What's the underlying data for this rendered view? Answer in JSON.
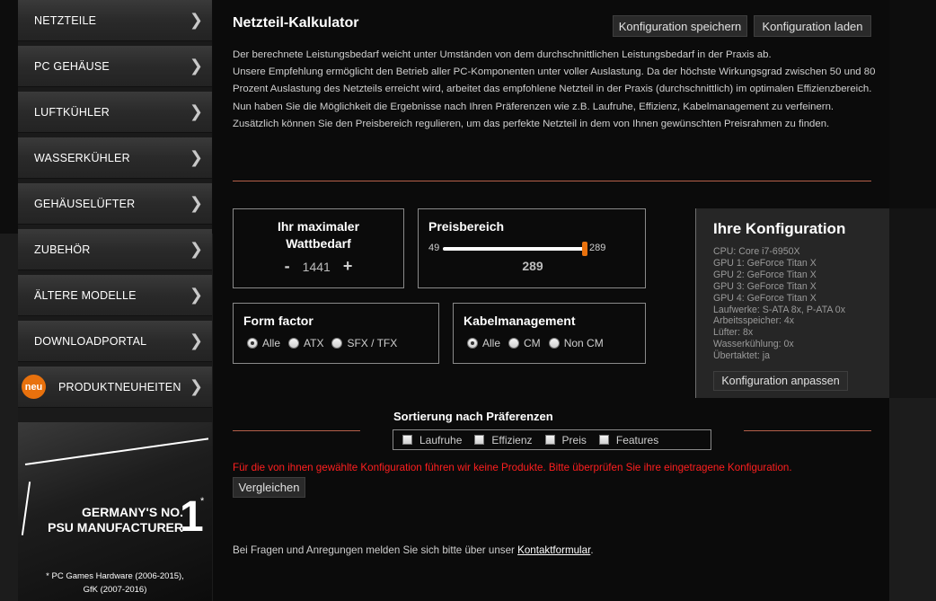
{
  "sidebar": {
    "items": [
      {
        "label": "NETZTEILE"
      },
      {
        "label": "PC GEHÄUSE"
      },
      {
        "label": "LUFTKÜHLER"
      },
      {
        "label": "WASSERKÜHLER"
      },
      {
        "label": "GEHÄUSELÜFTER"
      },
      {
        "label": "ZUBEHÖR"
      },
      {
        "label": "ÄLTERE MODELLE"
      },
      {
        "label": "DOWNLOADPORTAL"
      },
      {
        "label": "PRODUKTNEUHEITEN",
        "badge": "neu"
      }
    ],
    "chevron_icon": "chevron-right-icon",
    "promo": {
      "line1": "GERMANY'S NO.",
      "line2": "PSU MANUFACTURER",
      "number": "1",
      "star": "*",
      "footnote1": "* PC Games Hardware (2006-2015),",
      "footnote2": "GfK (2007-2016)"
    }
  },
  "main": {
    "title": "Netzteil-Kalkulator",
    "save_button": "Konfiguration speichern",
    "load_button": "Konfiguration laden",
    "intro": [
      "Der berechnete Leistungsbedarf weicht unter Umständen von dem durchschnittlichen Leistungsbedarf in der Praxis ab.",
      "Unsere Empfehlung ermöglicht den Betrieb aller PC-Komponenten unter voller Auslastung. Da der höchste Wirkungsgrad zwischen 50 und 80 Prozent Auslastung des Netzteils erreicht wird, arbeitet das empfohlene Netzteil in der Praxis (durchschnittlich) im optimalen Effizienzbereich.",
      "Nun haben Sie die Möglichkeit die Ergebnisse nach Ihren Präferenzen wie z.B. Laufruhe, Effizienz, Kabelmanagement zu verfeinern. Zusätzlich können Sie den Preisbereich regulieren, um das perfekte Netzteil in dem von Ihnen gewünschten Preisrahmen zu finden."
    ],
    "watt": {
      "title_line1": "Ihr maximaler",
      "title_line2": "Wattbedarf",
      "minus": "-",
      "value": "1441",
      "plus": "+"
    },
    "price": {
      "title": "Preisbereich",
      "min": "49",
      "max": "289",
      "value": "289",
      "slider_level": 1.0
    },
    "form_factor": {
      "title": "Form factor",
      "options": [
        {
          "label": "Alle",
          "selected": true
        },
        {
          "label": "ATX",
          "selected": false
        },
        {
          "label": "SFX / TFX",
          "selected": false
        }
      ]
    },
    "cable": {
      "title": "Kabelmanagement",
      "options": [
        {
          "label": "Alle",
          "selected": true
        },
        {
          "label": "CM",
          "selected": false
        },
        {
          "label": "Non CM",
          "selected": false
        }
      ]
    },
    "config": {
      "title": "Ihre Konfiguration",
      "lines": [
        "CPU: Core i7-6950X",
        "GPU 1: GeForce Titan X",
        "GPU 2: GeForce Titan X",
        "GPU 3: GeForce Titan X",
        "GPU 4: GeForce Titan X",
        "Laufwerke: S-ATA 8x, P-ATA 0x",
        "Arbeitsspeicher: 4x",
        "Lüfter: 8x",
        "Wasserkühlung: 0x",
        "Übertaktet: ja"
      ],
      "adjust_button": "Konfiguration anpassen"
    },
    "sort": {
      "title": "Sortierung nach Präferenzen",
      "options": [
        "Laufruhe",
        "Effizienz",
        "Preis",
        "Features"
      ]
    },
    "error": "Für die von ihnen gewählte Konfiguration führen wir keine Produkte. Bitte überprüfen Sie ihre eingetragene Konfiguration.",
    "compare_button": "Vergleichen",
    "footer_text": "Bei Fragen und Anregungen melden Sie sich bitte über unser ",
    "footer_link": "Kontaktformular",
    "footer_end": "."
  },
  "colors": {
    "accent": "#e8710d",
    "error": "#ff1f1f",
    "divider": "#b5604a"
  }
}
